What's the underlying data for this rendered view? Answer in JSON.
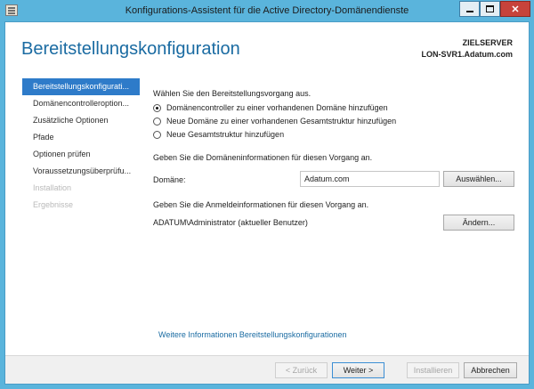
{
  "window": {
    "title": "Konfigurations-Assistent für die Active Directory-Domänendienste",
    "minimize_icon": "minimize-icon",
    "maximize_icon": "maximize-icon",
    "close_icon": "close-icon",
    "close_symbol": "✕"
  },
  "header": {
    "page_title": "Bereitstellungskonfiguration",
    "target_label": "ZIELSERVER",
    "target_server": "LON-SVR1.Adatum.com"
  },
  "sidebar": {
    "items": [
      {
        "label": "Bereitstellungskonfigurati...",
        "state": "active"
      },
      {
        "label": "Domänencontrolleroption...",
        "state": "normal"
      },
      {
        "label": "Zusätzliche Optionen",
        "state": "normal"
      },
      {
        "label": "Pfade",
        "state": "normal"
      },
      {
        "label": "Optionen prüfen",
        "state": "normal"
      },
      {
        "label": "Voraussetzungsüberprüfu...",
        "state": "normal"
      },
      {
        "label": "Installation",
        "state": "disabled"
      },
      {
        "label": "Ergebnisse",
        "state": "disabled"
      }
    ]
  },
  "main": {
    "intro": "Wählen Sie den Bereitstellungsvorgang aus.",
    "options": [
      {
        "label": "Domänencontroller zu einer vorhandenen Domäne hinzufügen",
        "checked": true
      },
      {
        "label": "Neue Domäne zu einer vorhandenen Gesamtstruktur hinzufügen",
        "checked": false
      },
      {
        "label": "Neue Gesamtstruktur hinzufügen",
        "checked": false
      }
    ],
    "domain_section": "Geben Sie die Domäneninformationen für diesen Vorgang an.",
    "domain_label": "Domäne:",
    "domain_value": "Adatum.com",
    "select_button": "Auswählen...",
    "credentials_section": "Geben Sie die Anmeldeinformationen für diesen Vorgang an.",
    "current_user": "ADATUM\\Administrator (aktueller Benutzer)",
    "change_button": "Ändern..."
  },
  "links": {
    "more_info": "Weitere Informationen Bereitstellungskonfigurationen"
  },
  "footer": {
    "back": "< Zurück",
    "next": "Weiter >",
    "install": "Installieren",
    "cancel": "Abbrechen"
  },
  "colors": {
    "title_bar": "#5ab4dc",
    "accent": "#1a6ba2",
    "nav_active": "#2e7bc9",
    "close_button": "#c7433b"
  }
}
